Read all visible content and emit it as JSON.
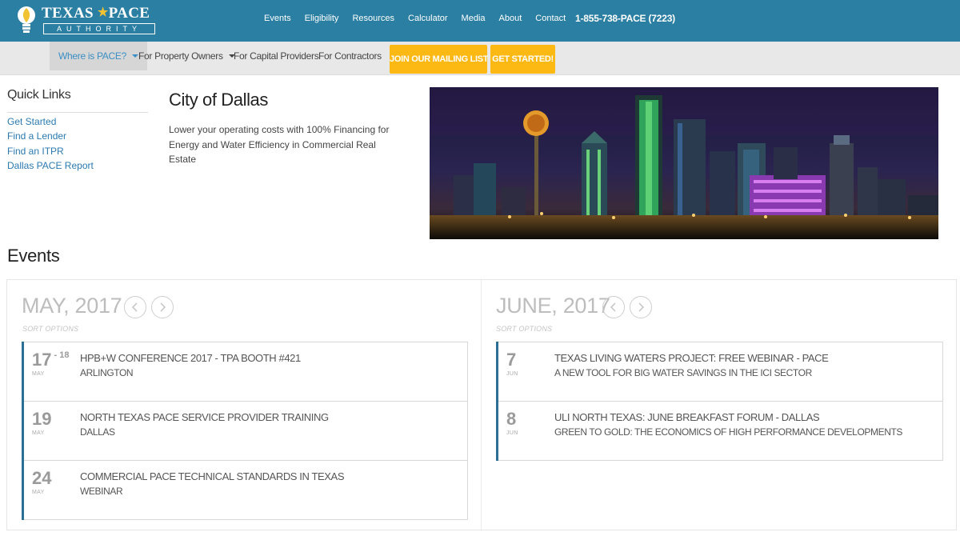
{
  "header": {
    "logo_title_1": "TEXAS",
    "logo_star": "★",
    "logo_title_2": "PACE",
    "logo_sub": "AUTHORITY",
    "nav": [
      "Events",
      "Eligibility",
      "Resources",
      "Calculator",
      "Media",
      "About",
      "Contact"
    ],
    "phone": "1-855-738-PACE (7223)",
    "colors": {
      "bar": "#2b7fa3",
      "accent_yellow": "#fdb913"
    }
  },
  "subnav": {
    "where_is_pace": "Where is PACE?",
    "property_owners": "For Property Owners",
    "capital_providers": "For Capital Providers",
    "contractors": "For Contractors",
    "mailing_list": "JOIN OUR MAILING LIST",
    "get_started": "GET STARTED!"
  },
  "quick_links": {
    "title": "Quick Links",
    "items": [
      "Get Started",
      "Find a Lender",
      "Find an ITPR",
      "Dallas PACE Report"
    ]
  },
  "city": {
    "title": "City of Dallas",
    "description": "Lower your operating costs with 100% Financing for Energy and Water Efficiency in Commercial Real Estate"
  },
  "events": {
    "title": "Events",
    "sort_label": "SORT OPTIONS",
    "months": [
      {
        "label": "MAY, 2017",
        "items": [
          {
            "day": "17",
            "day_end": "- 18",
            "mon": "MAY",
            "title": "HPB+W CONFERENCE 2017 - TPA BOOTH #421",
            "sub": "ARLINGTON"
          },
          {
            "day": "19",
            "day_end": "",
            "mon": "MAY",
            "title": "NORTH TEXAS PACE SERVICE PROVIDER TRAINING",
            "sub": "DALLAS"
          },
          {
            "day": "24",
            "day_end": "",
            "mon": "MAY",
            "title": "COMMERCIAL PACE TECHNICAL STANDARDS IN TEXAS",
            "sub": "WEBINAR"
          }
        ]
      },
      {
        "label": "JUNE, 2017",
        "items": [
          {
            "day": "7",
            "day_end": "",
            "mon": "JUN",
            "title": "TEXAS LIVING WATERS PROJECT: FREE WEBINAR - PACE",
            "sub": "A NEW TOOL FOR BIG WATER SAVINGS IN THE ICI SECTOR"
          },
          {
            "day": "8",
            "day_end": "",
            "mon": "JUN",
            "title": "ULI NORTH TEXAS: JUNE BREAKFAST FORUM - DALLAS",
            "sub": "GREEN TO GOLD: THE ECONOMICS OF HIGH PERFORMANCE DEVELOPMENTS"
          }
        ]
      }
    ]
  }
}
